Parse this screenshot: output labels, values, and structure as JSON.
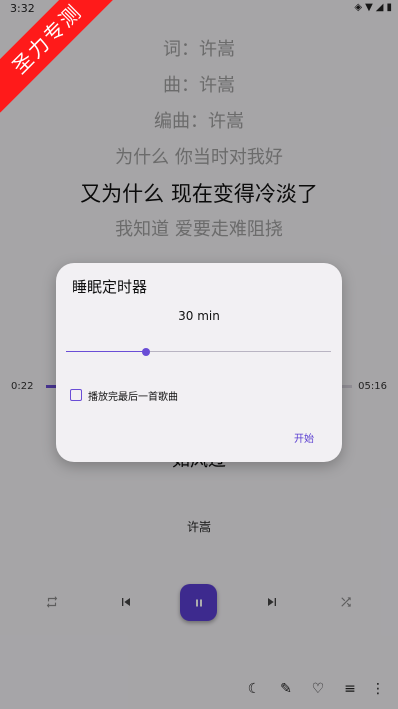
{
  "status_bar": {
    "time": "3:32"
  },
  "watermark": "圣力专测",
  "lyrics": [
    {
      "text": "词：许嵩",
      "current": false
    },
    {
      "text": "曲：许嵩",
      "current": false
    },
    {
      "text": "编曲：许嵩",
      "current": false
    },
    {
      "text": "为什么 你当时对我好",
      "current": false
    },
    {
      "text": "又为什么 现在变得冷淡了",
      "current": true
    },
    {
      "text": "我知道 爱要走难阻挠",
      "current": false
    },
    {
      "text": "",
      "current": false
    }
  ],
  "progress": {
    "elapsed": "0:22",
    "total": "05:16",
    "fraction": 0.07
  },
  "song": {
    "title": "如风过",
    "artist": "许嵩"
  },
  "controls": {
    "repeat": "repeat-icon",
    "prev": "skip-previous-icon",
    "play": "pause-icon",
    "next": "skip-next-icon",
    "shuffle": "shuffle-icon"
  },
  "bottom_bar": [
    {
      "name": "sleep-timer-icon",
      "glyph": "☾"
    },
    {
      "name": "lyrics-icon",
      "glyph": "✎"
    },
    {
      "name": "favorite-icon",
      "glyph": "♡"
    },
    {
      "name": "playlist-icon",
      "glyph": "≡"
    },
    {
      "name": "more-vertical-icon",
      "glyph": "⋮"
    }
  ],
  "dialog": {
    "title": "睡眠定时器",
    "value_label": "30 min",
    "slider_fraction": 0.3,
    "checkbox_label": "播放完最后一首歌曲",
    "checkbox_checked": false,
    "start_label": "开始"
  },
  "colors": {
    "accent": "#5b3fd1",
    "watermark": "#ff1a1a"
  }
}
